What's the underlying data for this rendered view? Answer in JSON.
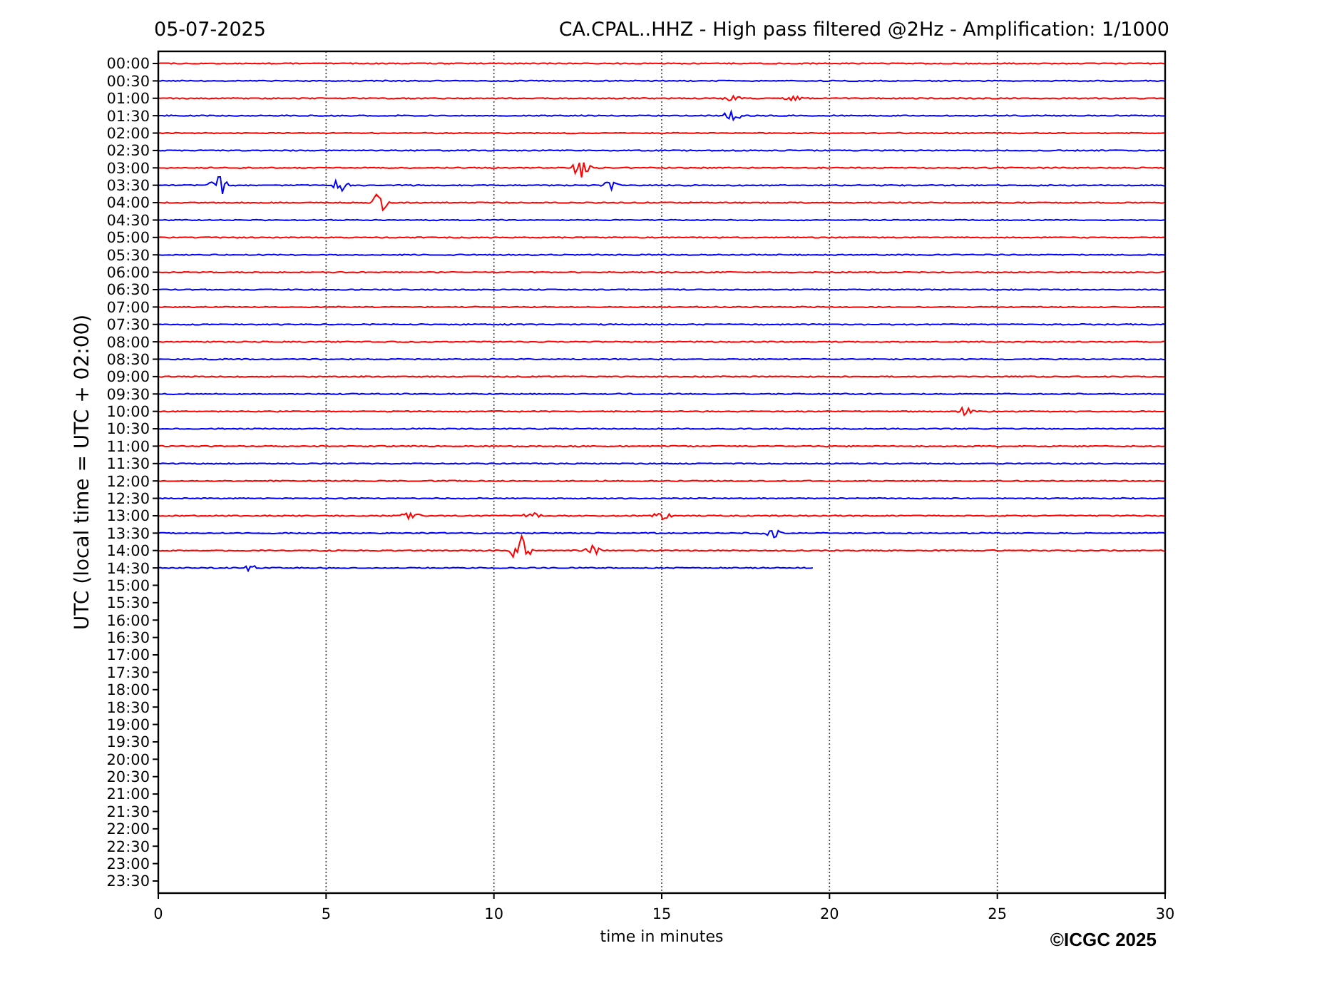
{
  "date": "05-07-2025",
  "title": "CA.CPAL..HHZ - High pass filtered @2Hz - Amplification: 1/1000",
  "chart": {
    "ylabel": "UTC (local time = UTC + 02:00)",
    "xlabel": "time in minutes",
    "xticks": [
      "0",
      "5",
      "10",
      "15",
      "20",
      "25",
      "30"
    ],
    "rows": [
      {
        "label": "00:00",
        "color": "#ff0000",
        "level": 1
      },
      {
        "label": "00:30",
        "color": "#0000ff",
        "level": 1
      },
      {
        "label": "01:00",
        "color": "#ff0000",
        "level": 1
      },
      {
        "label": "01:30",
        "color": "#0000ff",
        "level": 1
      },
      {
        "label": "02:00",
        "color": "#ff0000",
        "level": 1
      },
      {
        "label": "02:30",
        "color": "#0000ff",
        "level": 1
      },
      {
        "label": "03:00",
        "color": "#ff0000",
        "level": 1
      },
      {
        "label": "03:30",
        "color": "#0000ff",
        "level": 1
      },
      {
        "label": "04:00",
        "color": "#ff0000",
        "level": 1
      },
      {
        "label": "04:30",
        "color": "#0000ff",
        "level": 1
      },
      {
        "label": "05:00",
        "color": "#ff0000",
        "level": 1
      },
      {
        "label": "05:30",
        "color": "#0000ff",
        "level": 1
      },
      {
        "label": "06:00",
        "color": "#ff0000",
        "level": 1
      },
      {
        "label": "06:30",
        "color": "#0000ff",
        "level": 1
      },
      {
        "label": "07:00",
        "color": "#ff0000",
        "level": 1
      },
      {
        "label": "07:30",
        "color": "#0000ff",
        "level": 1
      },
      {
        "label": "08:00",
        "color": "#ff0000",
        "level": 1
      },
      {
        "label": "08:30",
        "color": "#0000ff",
        "level": 1
      },
      {
        "label": "09:00",
        "color": "#ff0000",
        "level": 1
      },
      {
        "label": "09:30",
        "color": "#0000ff",
        "level": 1
      },
      {
        "label": "10:00",
        "color": "#ff0000",
        "level": 1
      },
      {
        "label": "10:30",
        "color": "#0000ff",
        "level": 1
      },
      {
        "label": "11:00",
        "color": "#ff0000",
        "level": 1
      },
      {
        "label": "11:30",
        "color": "#0000ff",
        "level": 1
      },
      {
        "label": "12:00",
        "color": "#ff0000",
        "level": 1
      },
      {
        "label": "12:30",
        "color": "#0000ff",
        "level": 1
      },
      {
        "label": "13:00",
        "color": "#ff0000",
        "level": 1
      },
      {
        "label": "13:30",
        "color": "#0000ff",
        "level": 1
      },
      {
        "label": "14:00",
        "color": "#ff0000",
        "level": 1
      },
      {
        "label": "14:30",
        "color": "#0000ff",
        "level": 0.65
      },
      {
        "label": "15:00"
      },
      {
        "label": "15:30"
      },
      {
        "label": "16:00"
      },
      {
        "label": "16:30"
      },
      {
        "label": "17:00"
      },
      {
        "label": "17:30"
      },
      {
        "label": "18:00"
      },
      {
        "label": "18:30"
      },
      {
        "label": "19:00"
      },
      {
        "label": "19:30"
      },
      {
        "label": "20:00"
      },
      {
        "label": "20:30"
      },
      {
        "label": "21:00"
      },
      {
        "label": "21:30"
      },
      {
        "label": "22:00"
      },
      {
        "label": "22:30"
      },
      {
        "label": "23:00"
      },
      {
        "label": "23:30"
      }
    ]
  },
  "copyright": "©ICGC 2025"
}
